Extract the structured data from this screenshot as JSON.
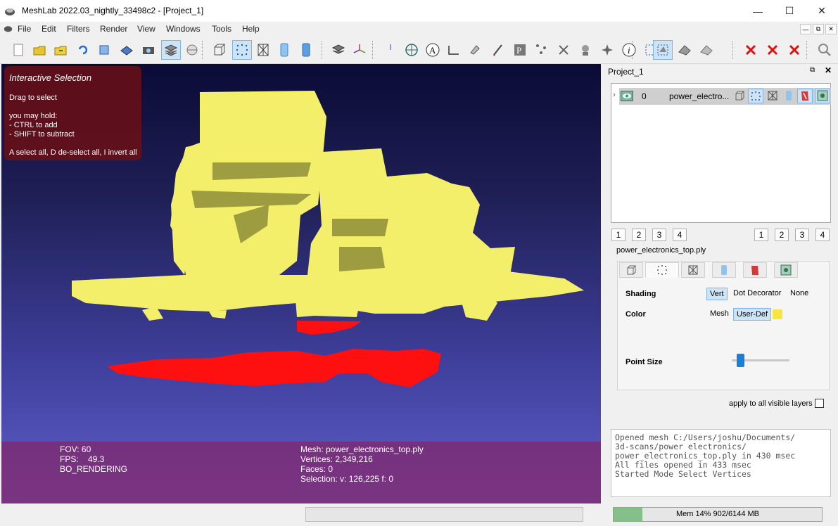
{
  "window": {
    "title": "MeshLab 2022.03_nightly_33498c2 - [Project_1]"
  },
  "menu": [
    "File",
    "Edit",
    "Filters",
    "Render",
    "View",
    "Windows",
    "Tools",
    "Help"
  ],
  "toolbar_icons": [
    "new-project-icon",
    "open-project-icon",
    "import-mesh-icon",
    "reload-icon",
    "reload-all-icon",
    "export-mesh-icon",
    "snapshot-icon",
    "layers-icon",
    "textures-icon",
    "bbox-render-icon",
    "points-render-icon",
    "wireframe-render-icon",
    "flat-render-icon",
    "smooth-render-icon",
    "light-on-icon",
    "axis-icon",
    "ortho-axis-icon",
    "globe-icon",
    "text-icon",
    "measure-icon",
    "paint-icon",
    "brush-icon",
    "pick-icon",
    "align-icon",
    "manipulator-icon",
    "point-picker-icon",
    "georef-icon",
    "info-icon",
    "select-vertices-icon",
    "select-faces-icon",
    "select-connected-icon",
    "select-poly-icon",
    "delete-vertices-icon",
    "delete-faces-icon",
    "delete-all-icon",
    "search-icon"
  ],
  "selection_help": {
    "title": "Interactive Selection",
    "lines": [
      "Drag to select",
      "you may hold:",
      "- CTRL to add",
      "- SHIFT to subtract",
      "A select all, D de-select all, I invert all"
    ]
  },
  "viewport_info": {
    "fov": "FOV: 60",
    "fps_label": "FPS:",
    "fps_value": "49.3",
    "rendering": "BO_RENDERING",
    "mesh": "Mesh: power_electronics_top.ply",
    "vertices": "Vertices: 2,349,216",
    "faces": "Faces: 0",
    "selection": "Selection: v: 126,225 f: 0"
  },
  "dock": {
    "title": "Project_1",
    "layer": {
      "index": "0",
      "name": "power_electro..."
    },
    "view_buttons_left": [
      "1",
      "2",
      "3",
      "4"
    ],
    "view_buttons_right": [
      "1",
      "2",
      "3",
      "4"
    ],
    "mesh_name": "power_electronics_top.ply",
    "shading_label": "Shading",
    "shading_options": [
      "Vert",
      "Dot Decorator",
      "None"
    ],
    "color_label": "Color",
    "color_options": [
      "Mesh",
      "User-Def"
    ],
    "user_color": "#f5e642",
    "point_size_label": "Point Size",
    "point_size_fraction": 0.1,
    "apply_label": "apply to all visible layers",
    "apply_checked": false
  },
  "log": [
    "Opened mesh C:/Users/joshu/Documents/",
    "3d-scans/power electronics/",
    "power_electronics_top.ply in 430 msec",
    "All files opened in 433 msec",
    "Started Mode Select Vertices"
  ],
  "memory": {
    "text": "Mem 14% 902/6144 MB",
    "fraction": 0.14
  },
  "colors": {
    "mesh_yellow": "#f3ef6a",
    "selection_red": "#ff1010",
    "accent_blue": "#1a7fd6"
  }
}
